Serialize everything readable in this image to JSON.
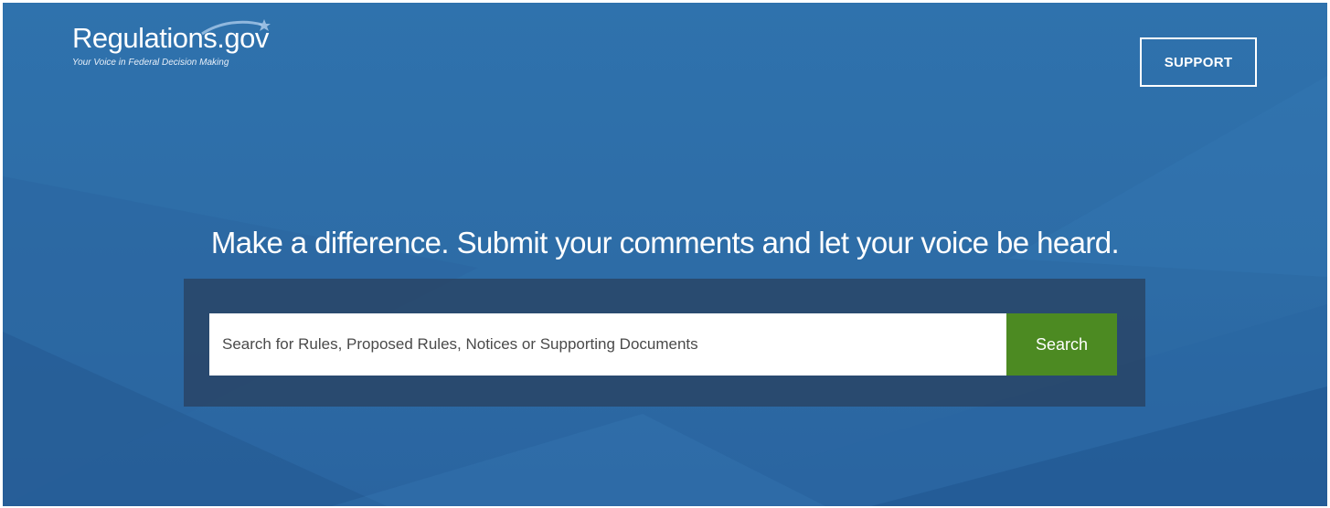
{
  "header": {
    "logo_title": "Regulations.gov",
    "logo_tagline": "Your Voice in Federal Decision Making",
    "support_label": "SUPPORT"
  },
  "hero": {
    "headline": "Make a difference. Submit your comments and let your voice be heard."
  },
  "search": {
    "placeholder": "Search for Rules, Proposed Rules, Notices or Supporting Documents",
    "button_label": "Search"
  },
  "colors": {
    "background": "#2f72ad",
    "search_button": "#4c8a22",
    "panel": "#283e5c"
  }
}
